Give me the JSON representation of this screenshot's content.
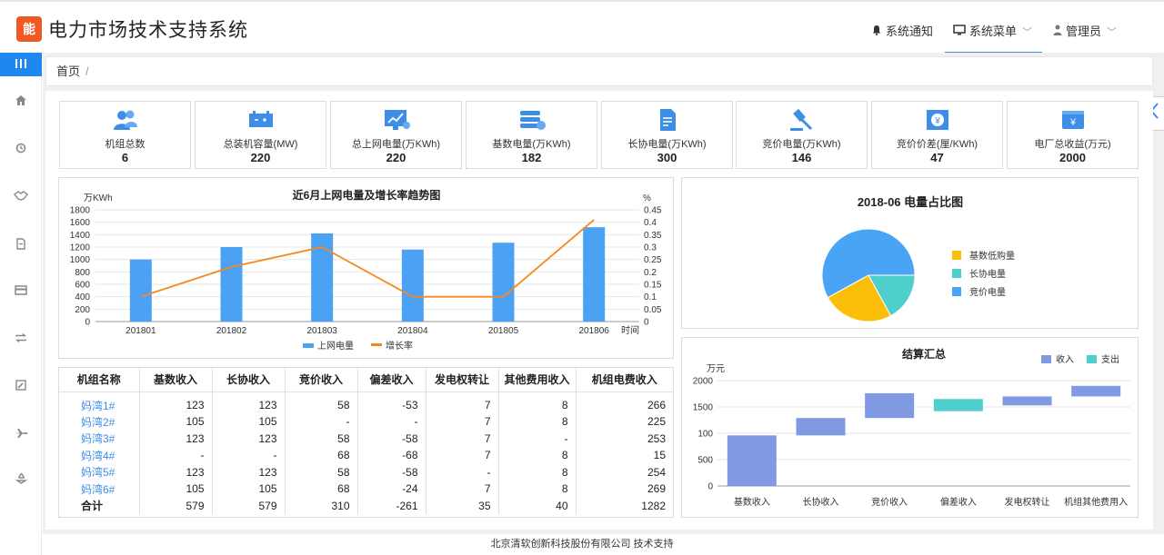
{
  "app": {
    "title": "电力市场技术支持系统",
    "logo_text": "能"
  },
  "nav": {
    "notifications": "系统通知",
    "menu": "系统菜单",
    "user": "管理员"
  },
  "breadcrumb": {
    "home": "首页",
    "sep": "/"
  },
  "kpis": [
    {
      "label": "机组总数",
      "value": "6",
      "icon": "users-icon"
    },
    {
      "label": "总装机容量(MW)",
      "value": "220",
      "icon": "battery-icon"
    },
    {
      "label": "总上网电量(万KWh)",
      "value": "220",
      "icon": "monitor-chart-icon"
    },
    {
      "label": "基数电量(万KWh)",
      "value": "182",
      "icon": "database-icon"
    },
    {
      "label": "长协电量(万KWh)",
      "value": "300",
      "icon": "document-icon"
    },
    {
      "label": "竞价电量(万KWh)",
      "value": "146",
      "icon": "gavel-icon"
    },
    {
      "label": "竞价价差(厘/KWh)",
      "value": "47",
      "icon": "yen-card-icon"
    },
    {
      "label": "电厂总收益(万元)",
      "value": "2000",
      "icon": "yen-wallet-icon"
    }
  ],
  "colors": {
    "accent": "#3e8ee8",
    "bar": "#4ba2f5",
    "line": "#f5891f",
    "pie_yellow": "#fbbf0a",
    "pie_teal": "#4fcfcc",
    "pie_blue": "#4aa4f5",
    "wf_up": "#8099e3",
    "wf_down": "#50cfcf"
  },
  "chart_data": [
    {
      "type": "bar",
      "title": "近6月上网电量及增长率趋势图",
      "categories": [
        "201801",
        "201802",
        "201803",
        "201804",
        "201805",
        "201806"
      ],
      "xlabel": "时间",
      "ylabel": "万KWh",
      "y2label": "%",
      "ylim": [
        0,
        1800
      ],
      "yticks": [
        "0",
        "200",
        "400",
        "600",
        "800",
        "1000",
        "1200",
        "1400",
        "1600",
        "1800"
      ],
      "y2lim": [
        0,
        0.45
      ],
      "y2ticks": [
        "0",
        "0.05",
        "0.1",
        "0.15",
        "0.2",
        "0.25",
        "0.3",
        "0.35",
        "0.4",
        "0.45"
      ],
      "series": [
        {
          "name": "上网电量",
          "type": "bar",
          "values": [
            1000,
            1200,
            1420,
            1160,
            1270,
            1520
          ]
        },
        {
          "name": "增长率",
          "type": "line",
          "axis": "right",
          "values": [
            0.1,
            0.22,
            0.3,
            0.1,
            0.1,
            0.41
          ]
        }
      ],
      "legend": "bottom"
    },
    {
      "type": "pie",
      "title": "2018-06 电量占比图",
      "labels": [
        "基数低购量",
        "长协电量",
        "竞价电量"
      ],
      "values": [
        25,
        17,
        58
      ],
      "legend": "right"
    },
    {
      "type": "bar",
      "subtype": "waterfall",
      "title": "结算汇总",
      "ylabel": "万元",
      "yticks": [
        "0",
        "500",
        "100",
        "1500",
        "2000"
      ],
      "ylim": [
        0,
        2000
      ],
      "categories": [
        "基数收入",
        "长协收入",
        "竞价收入",
        "偏差收入",
        "发电权转让",
        "机组其他费用入"
      ],
      "series": [
        {
          "name": "收入",
          "values": [
            [
              0,
              960
            ],
            [
              960,
              1290
            ],
            [
              1290,
              1760
            ],
            null,
            [
              1530,
              1700
            ],
            [
              1700,
              1900
            ]
          ]
        },
        {
          "name": "支出",
          "values": [
            null,
            null,
            null,
            [
              1420,
              1650
            ],
            null,
            null
          ]
        }
      ],
      "legend": "top-right"
    }
  ],
  "settlement": {
    "headers": [
      "机组名称",
      "基数收入",
      "长协收入",
      "竞价收入",
      "偏差收入",
      "发电权转让",
      "其他费用收入",
      "机组电费收入"
    ],
    "rows": [
      [
        "妈湾1#",
        "123",
        "123",
        "58",
        "-53",
        "7",
        "8",
        "266"
      ],
      [
        "妈湾2#",
        "105",
        "105",
        "-",
        "-",
        "7",
        "8",
        "225"
      ],
      [
        "妈湾3#",
        "123",
        "123",
        "58",
        "-58",
        "7",
        "-",
        "253"
      ],
      [
        "妈湾4#",
        "-",
        "-",
        "68",
        "-68",
        "7",
        "8",
        "15"
      ],
      [
        "妈湾5#",
        "123",
        "123",
        "58",
        "-58",
        "-",
        "8",
        "254"
      ],
      [
        "妈湾6#",
        "105",
        "105",
        "68",
        "-24",
        "7",
        "8",
        "269"
      ],
      [
        "合计",
        "579",
        "579",
        "310",
        "-261",
        "35",
        "40",
        "1282"
      ]
    ]
  },
  "footer": "北京清软创新科技股份有限公司  技术支持"
}
